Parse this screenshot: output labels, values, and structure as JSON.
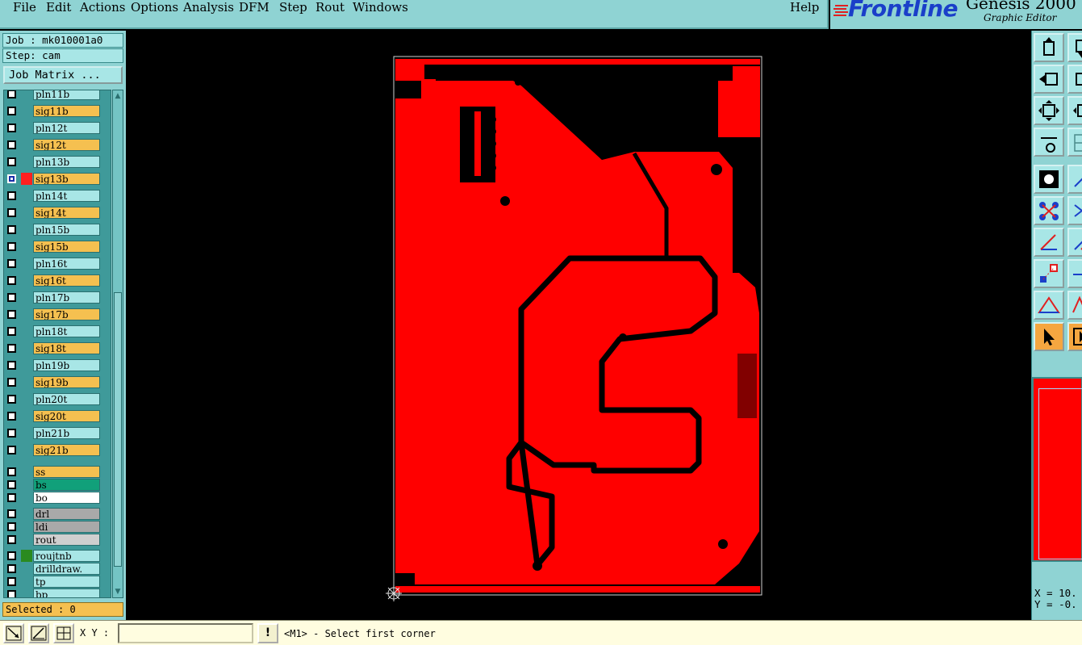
{
  "menu": {
    "items": [
      "File",
      "Edit",
      "Actions",
      "Options",
      "Analysis",
      "DFM",
      "Step",
      "Rout",
      "Windows"
    ],
    "help": "Help"
  },
  "brand": {
    "logo": "Frontline",
    "product": "Genesis 2000",
    "subtitle": "Graphic Editor"
  },
  "job": {
    "job_label": "Job : mk010001a0",
    "step_label": "Step: cam",
    "matrix_button": "Job Matrix ..."
  },
  "layers": [
    {
      "name": "pln11b",
      "type": "board"
    },
    {
      "name": "sig11b",
      "type": "signal"
    },
    {
      "name": "pln12t",
      "type": "board"
    },
    {
      "name": "sig12t",
      "type": "signal"
    },
    {
      "name": "pln13b",
      "type": "board"
    },
    {
      "name": "sig13b",
      "type": "signal",
      "selected": true,
      "color": "#ff2020"
    },
    {
      "name": "pln14t",
      "type": "board"
    },
    {
      "name": "sig14t",
      "type": "signal"
    },
    {
      "name": "pln15b",
      "type": "board"
    },
    {
      "name": "sig15b",
      "type": "signal"
    },
    {
      "name": "pln16t",
      "type": "board"
    },
    {
      "name": "sig16t",
      "type": "signal"
    },
    {
      "name": "pln17b",
      "type": "board"
    },
    {
      "name": "sig17b",
      "type": "signal"
    },
    {
      "name": "pln18t",
      "type": "board"
    },
    {
      "name": "sig18t",
      "type": "signal"
    },
    {
      "name": "pln19b",
      "type": "board"
    },
    {
      "name": "sig19b",
      "type": "signal"
    },
    {
      "name": "pln20t",
      "type": "board"
    },
    {
      "name": "sig20t",
      "type": "signal"
    },
    {
      "name": "pln21b",
      "type": "board"
    },
    {
      "name": "sig21b",
      "type": "signal"
    },
    {
      "name": "ss",
      "type": "ss"
    },
    {
      "name": "bs",
      "type": "bs"
    },
    {
      "name": "bo",
      "type": "bo"
    },
    {
      "name": "drl",
      "type": "drl"
    },
    {
      "name": "ldi",
      "type": "drl"
    },
    {
      "name": "rout",
      "type": "rout"
    },
    {
      "name": "roujtnb",
      "type": "board",
      "color": "#2a8a20"
    },
    {
      "name": "drilldraw.",
      "type": "board"
    },
    {
      "name": "tp",
      "type": "board"
    },
    {
      "name": "bp",
      "type": "board"
    }
  ],
  "selection": {
    "label": "Selected : 0"
  },
  "coords": {
    "x": "X = 10.",
    "y": "Y = -0."
  },
  "bottom": {
    "xy_label": "X Y :",
    "xy_value": "",
    "message_button": "!",
    "message": "<M1> - Select first corner"
  },
  "colors": {
    "panel": "#8fd3d3",
    "copper": "#ff0000",
    "signal_layer": "#f5c050"
  }
}
